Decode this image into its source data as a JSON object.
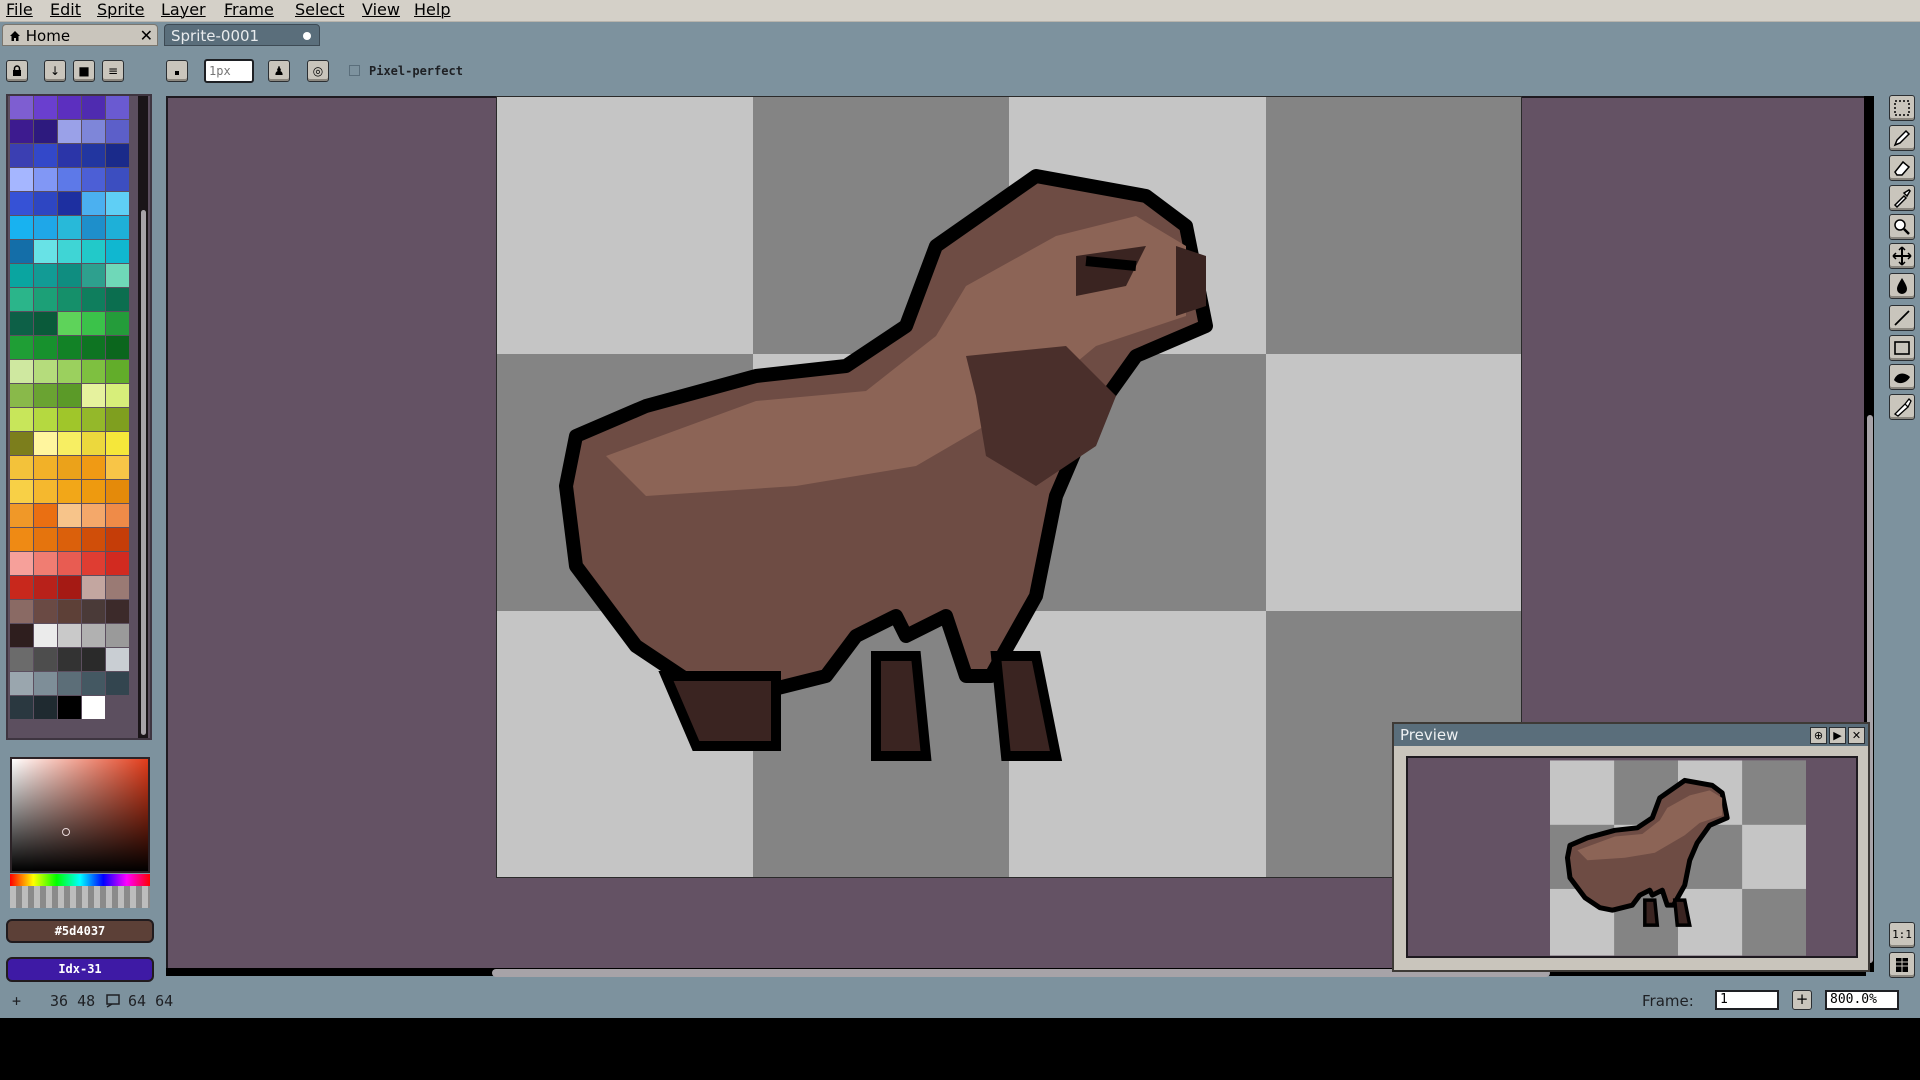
{
  "menu": [
    "File",
    "Edit",
    "Sprite",
    "Layer",
    "Frame",
    "Select",
    "View",
    "Help"
  ],
  "tabs": {
    "home_label": "Home",
    "sprite_label": "Sprite-0001"
  },
  "context_bar": {
    "brush_size_placeholder": "1px",
    "pixel_perfect_label": "Pixel-perfect"
  },
  "color": {
    "hex": "#5d4037",
    "index": "Idx-31"
  },
  "status": {
    "cursor": "36 48",
    "size": "64 64"
  },
  "frame": {
    "label": "Frame:",
    "value": "1",
    "zoom": "800.0%"
  },
  "preview": {
    "title": "Preview"
  },
  "palette": [
    "#7e5ed1",
    "#6a3fcf",
    "#5c2fbf",
    "#4f2bb0",
    "#6a5ad1",
    "#3d1b8f",
    "#2d1a7e",
    "#9aa1e8",
    "#7e86d9",
    "#5c5fc9",
    "#3b3fb2",
    "#3348c9",
    "#2b35a8",
    "#2236a0",
    "#1a2a8a",
    "#a5b6ff",
    "#8197f5",
    "#5d79e8",
    "#4c5fd6",
    "#3c4ec0",
    "#3652d6",
    "#2e46c2",
    "#1d2fa0",
    "#4bb0f0",
    "#5fcff5",
    "#18b2f0",
    "#1fa7e8",
    "#28b9d9",
    "#1e8fcb",
    "#1eb0d8",
    "#146ea8",
    "#68e2e6",
    "#3fd5d5",
    "#22c9c9",
    "#10b7d0",
    "#0aa5a0",
    "#129b95",
    "#0f8d80",
    "#2ea08e",
    "#6fd8b8",
    "#2bb58a",
    "#1ca077",
    "#15906a",
    "#0f7e5d",
    "#0b6e4f",
    "#0d6047",
    "#0a5a3a",
    "#5ed35a",
    "#3bc24a",
    "#249c3a",
    "#1f9e35",
    "#17912d",
    "#128226",
    "#0e7422",
    "#0b661d",
    "#cfe8a0",
    "#b5dc7c",
    "#9bd05e",
    "#7ec040",
    "#62ad2a",
    "#89b94a",
    "#6aa332",
    "#5b9a28",
    "#e6f29e",
    "#d7ee7a",
    "#c8e65a",
    "#b5d940",
    "#a0c62a",
    "#94b82a",
    "#7f9f1f",
    "#7c7e1c",
    "#fff59e",
    "#f7ee62",
    "#ecd83d",
    "#f5e73a",
    "#f3c23a",
    "#f2b128",
    "#eba21a",
    "#f09a14",
    "#f8c547",
    "#f8d046",
    "#f5b82e",
    "#f2a718",
    "#ee9a0f",
    "#e48a0a",
    "#f09828",
    "#ea6f12",
    "#f7c48a",
    "#f4a86a",
    "#ef8b48",
    "#ef8a14",
    "#e5740d",
    "#db600b",
    "#d04e09",
    "#c53d08",
    "#f6a09a",
    "#f07d72",
    "#e85c52",
    "#df3d32",
    "#d22a20",
    "#c8281c",
    "#b8211a",
    "#a51a14",
    "#c3a6a0",
    "#9a7a74",
    "#8a6a64",
    "#6a4a44",
    "#5d4037",
    "#4a3a38",
    "#3c2a2a",
    "#2e1e1e",
    "#ebebeb",
    "#c9c9c9",
    "#b1b1b1",
    "#9a9a9a",
    "#6b6b6b",
    "#4d4d4d",
    "#333333",
    "#2a2a2a",
    "#c9ced3",
    "#9aa6ae",
    "#7e8e98",
    "#5c6e78",
    "#445862",
    "#33454f",
    "#2a3840",
    "#1f2a30",
    "#000000",
    "#ffffff"
  ]
}
